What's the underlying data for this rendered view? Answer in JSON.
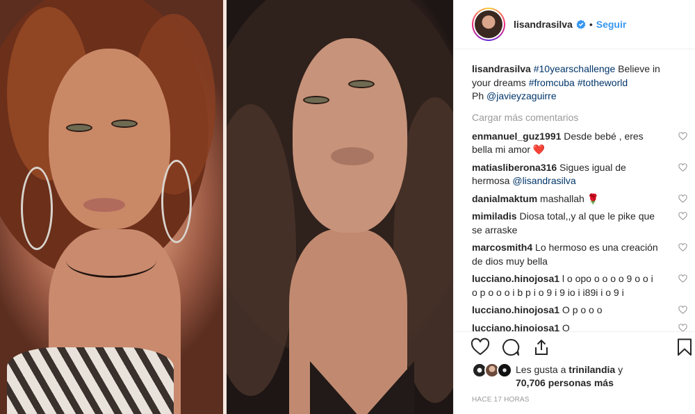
{
  "post": {
    "username": "lisandrasilva",
    "separator": "•",
    "follow_label": "Seguir",
    "caption": {
      "username": "lisandrasilva",
      "tag1": "#10yearschallenge",
      "text1": " Believe in your dreams ",
      "tag2": "#fromcuba",
      "space": " ",
      "tag3": "#totheworld",
      "credit_prefix": "Ph ",
      "credit_mention": "@javieyzaguirre"
    },
    "load_more_label": "Cargar más comentarios",
    "comments": [
      {
        "user": "enmanuel_guz1991",
        "text": " Desde bebé , eres bella mi amor ",
        "emoji": "❤️"
      },
      {
        "user": "matiasliberona316",
        "text": " Sigues igual de hermosa ",
        "mention": "@lisandrasilva"
      },
      {
        "user": "danialmaktum",
        "text": " mashallah ",
        "emoji": "🌹"
      },
      {
        "user": "mimiladis",
        "text": " Diosa total,,y al que le pike que se arraske"
      },
      {
        "user": "marcosmith4",
        "text": " Lo hermoso es una creación de dios muy bella"
      },
      {
        "user": "lucciano.hinojosa1",
        "text": " l o opo o o o o 9 o o i o p o o o i b p i o 9 i 9 io i i89i i o 9 i"
      },
      {
        "user": "lucciano.hinojosa1",
        "text": " O p o o o"
      },
      {
        "user": "lucciano.hinojosa1",
        "text": " O"
      }
    ],
    "likes": {
      "prefix": "Les gusta a ",
      "user": "trinilandia",
      "suffix": " y",
      "count_line_count": "70,706",
      "count_line_rest": " personas más"
    },
    "time_label": "HACE 17 HORAS"
  },
  "colors": {
    "link": "#3897f0",
    "hashtag": "#003569",
    "meta_gray": "#999999",
    "text": "#262626",
    "heart_red": "#ed4956"
  },
  "icons": [
    "verified-badge-icon",
    "heart-icon",
    "comment-icon",
    "share-icon",
    "bookmark-icon",
    "small-heart-icon"
  ]
}
